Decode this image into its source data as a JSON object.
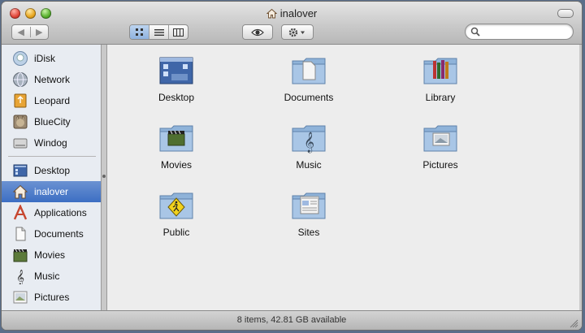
{
  "window": {
    "title": "inalover",
    "title_icon": "home-icon"
  },
  "toolbar": {
    "back_icon": "back-arrow-icon",
    "forward_icon": "forward-arrow-icon",
    "views": [
      {
        "name": "icon-view",
        "active": true
      },
      {
        "name": "list-view",
        "active": false
      },
      {
        "name": "column-view",
        "active": false
      }
    ],
    "quicklook_icon": "eye-icon",
    "action_icon": "gear-icon",
    "search_placeholder": ""
  },
  "sidebar": {
    "devices": [
      {
        "label": "iDisk",
        "icon": "idisk-icon"
      },
      {
        "label": "Network",
        "icon": "network-icon"
      },
      {
        "label": "Leopard",
        "icon": "drive-icon"
      },
      {
        "label": "BlueCity",
        "icon": "cat-drive-icon"
      },
      {
        "label": "Windog",
        "icon": "drive-icon"
      }
    ],
    "places": [
      {
        "label": "Desktop",
        "icon": "desktop-icon",
        "selected": false
      },
      {
        "label": "inalover",
        "icon": "home-icon",
        "selected": true
      },
      {
        "label": "Applications",
        "icon": "applications-icon",
        "selected": false
      },
      {
        "label": "Documents",
        "icon": "documents-icon",
        "selected": false
      },
      {
        "label": "Movies",
        "icon": "movies-icon",
        "selected": false
      },
      {
        "label": "Music",
        "icon": "music-icon",
        "selected": false
      },
      {
        "label": "Pictures",
        "icon": "pictures-icon",
        "selected": false
      }
    ]
  },
  "content": {
    "items": [
      {
        "label": "Desktop",
        "icon": "desktop-folder-icon"
      },
      {
        "label": "Documents",
        "icon": "documents-folder-icon"
      },
      {
        "label": "Library",
        "icon": "library-folder-icon"
      },
      {
        "label": "Movies",
        "icon": "movies-folder-icon"
      },
      {
        "label": "Music",
        "icon": "music-folder-icon"
      },
      {
        "label": "Pictures",
        "icon": "pictures-folder-icon"
      },
      {
        "label": "Public",
        "icon": "public-folder-icon"
      },
      {
        "label": "Sites",
        "icon": "sites-folder-icon"
      }
    ]
  },
  "status": {
    "text": "8 items, 42.81 GB available"
  },
  "colors": {
    "selection": "#3c6ec3",
    "sidebar_bg": "#e8ecf2",
    "folder_blue": "#8fb3d9"
  }
}
